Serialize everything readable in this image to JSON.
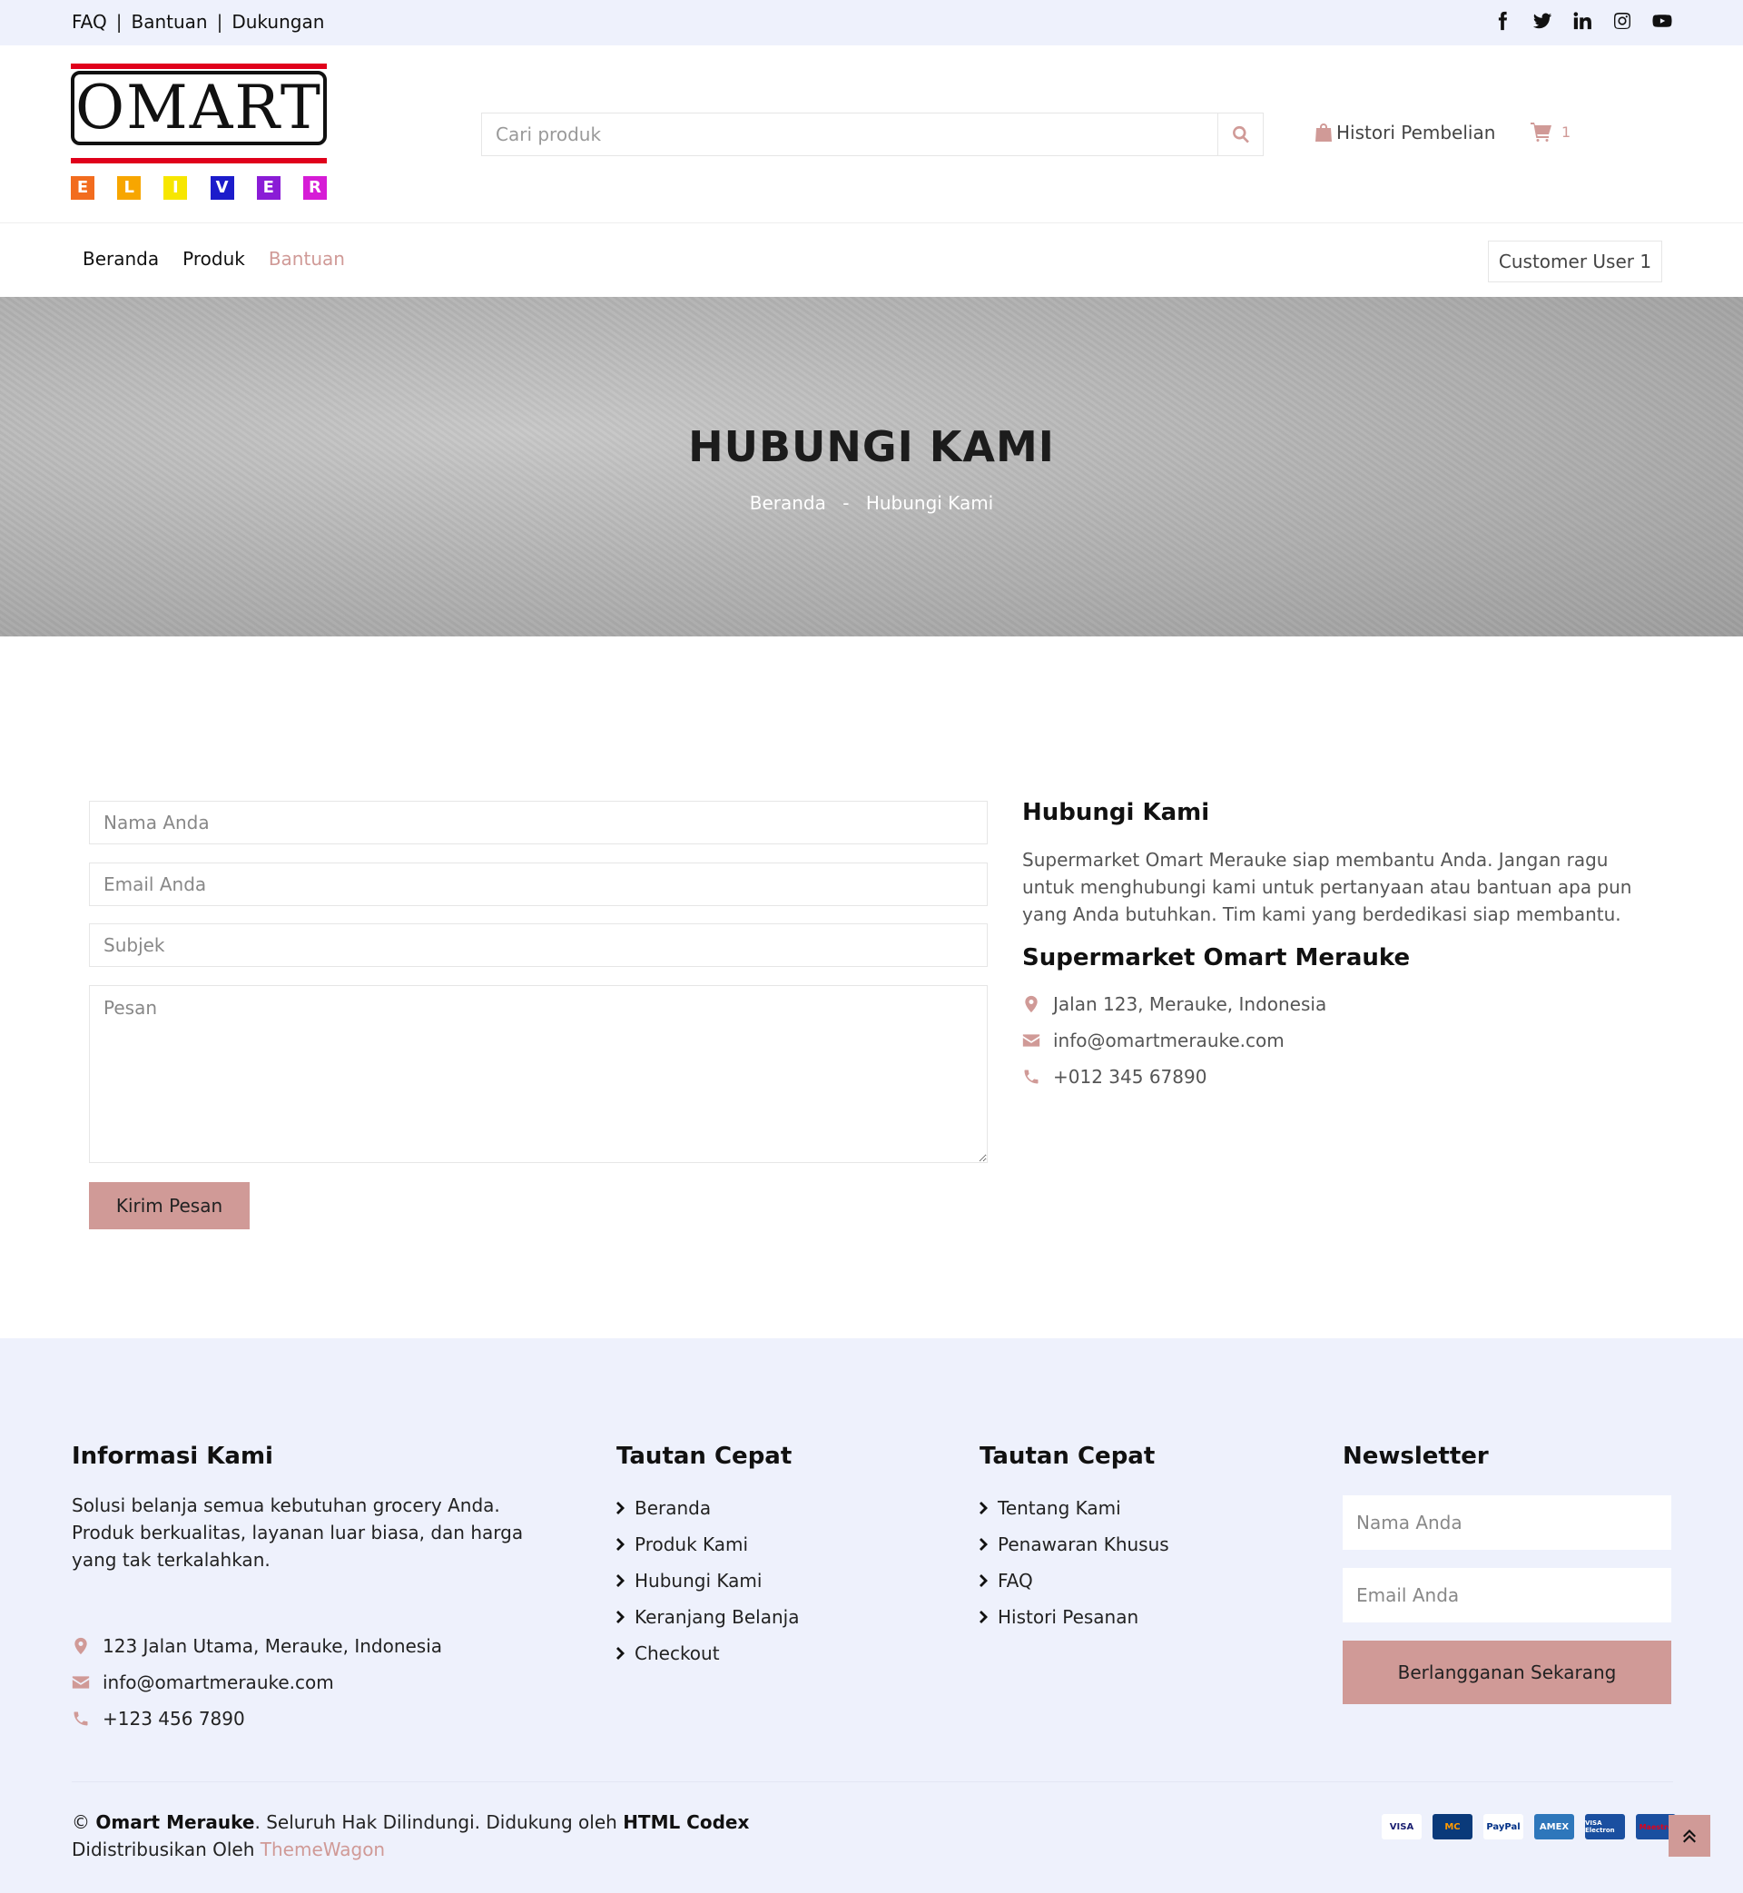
{
  "topbar": {
    "links": [
      "FAQ",
      "Bantuan",
      "Dukungan"
    ],
    "separator": "|",
    "social_icons": [
      "facebook-icon",
      "twitter-icon",
      "linkedin-icon",
      "instagram-icon",
      "youtube-icon"
    ]
  },
  "header": {
    "logo_text": "OMART",
    "logo_letters": [
      "E",
      "L",
      "I",
      "V",
      "E",
      "R"
    ],
    "logo_letter_colors": [
      "#f26c1e",
      "#f7a600",
      "#f7e600",
      "#1c1ccb",
      "#8a1cd6",
      "#d61cd6"
    ],
    "search_placeholder": "Cari produk",
    "history_label": "Histori Pembelian",
    "cart_count": "1"
  },
  "nav": {
    "items": [
      {
        "label": "Beranda",
        "active": false
      },
      {
        "label": "Produk",
        "active": false
      },
      {
        "label": "Bantuan",
        "active": true
      }
    ],
    "user_label": "Customer User 1"
  },
  "hero": {
    "title": "HUBUNGI KAMI",
    "breadcrumb": [
      "Beranda",
      "Hubungi Kami"
    ],
    "breadcrumb_sep": "-"
  },
  "form": {
    "name_placeholder": "Nama Anda",
    "email_placeholder": "Email Anda",
    "subject_placeholder": "Subjek",
    "message_placeholder": "Pesan",
    "submit_label": "Kirim Pesan"
  },
  "contact": {
    "title": "Hubungi Kami",
    "description": "Supermarket Omart Merauke siap membantu Anda. Jangan ragu untuk menghubungi kami untuk pertanyaan atau bantuan apa pun yang Anda butuhkan. Tim kami yang berdedikasi siap membantu.",
    "store_name": "Supermarket Omart Merauke",
    "address": "Jalan 123, Merauke, Indonesia",
    "email": "info@omartmerauke.com",
    "phone": "+012 345 67890"
  },
  "footer": {
    "info_title": "Informasi Kami",
    "info_text": "Solusi belanja semua kebutuhan grocery Anda. Produk berkualitas, layanan luar biasa, dan harga yang tak terkalahkan.",
    "address": "123 Jalan Utama, Merauke, Indonesia",
    "email": "info@omartmerauke.com",
    "phone": "+123 456 7890",
    "links1_title": "Tautan Cepat",
    "links1": [
      "Beranda",
      "Produk Kami",
      "Hubungi Kami",
      "Keranjang Belanja",
      "Checkout"
    ],
    "links2_title": "Tautan Cepat",
    "links2": [
      "Tentang Kami",
      "Penawaran Khusus",
      "FAQ",
      "Histori Pesanan"
    ],
    "newsletter_title": "Newsletter",
    "nl_name_placeholder": "Nama Anda",
    "nl_email_placeholder": "Email Anda",
    "nl_button": "Berlangganan Sekarang",
    "copyright_symbol": "©",
    "brand": "Omart Merauke",
    "rights": ". Seluruh Hak Dilindungi. Didukung oleh ",
    "powered_by": "HTML Codex",
    "distributed": "Didistribusikan Oleh ",
    "distributor": "ThemeWagon",
    "payments": [
      {
        "label": "VISA",
        "bg": "#ffffff",
        "fg": "#1a1f71"
      },
      {
        "label": "MC",
        "bg": "#0a3a7a",
        "fg": "#ff9a00"
      },
      {
        "label": "PayPal",
        "bg": "#ffffff",
        "fg": "#003087"
      },
      {
        "label": "AMEX",
        "bg": "#2e77bb",
        "fg": "#ffffff"
      },
      {
        "label": "VISA Electron",
        "bg": "#1a4fa0",
        "fg": "#ffffff"
      },
      {
        "label": "Maestro",
        "bg": "#1a4fa0",
        "fg": "#e0001b"
      }
    ]
  },
  "colors": {
    "accent": "#d09a97",
    "topbar_bg": "#eef1fc"
  }
}
